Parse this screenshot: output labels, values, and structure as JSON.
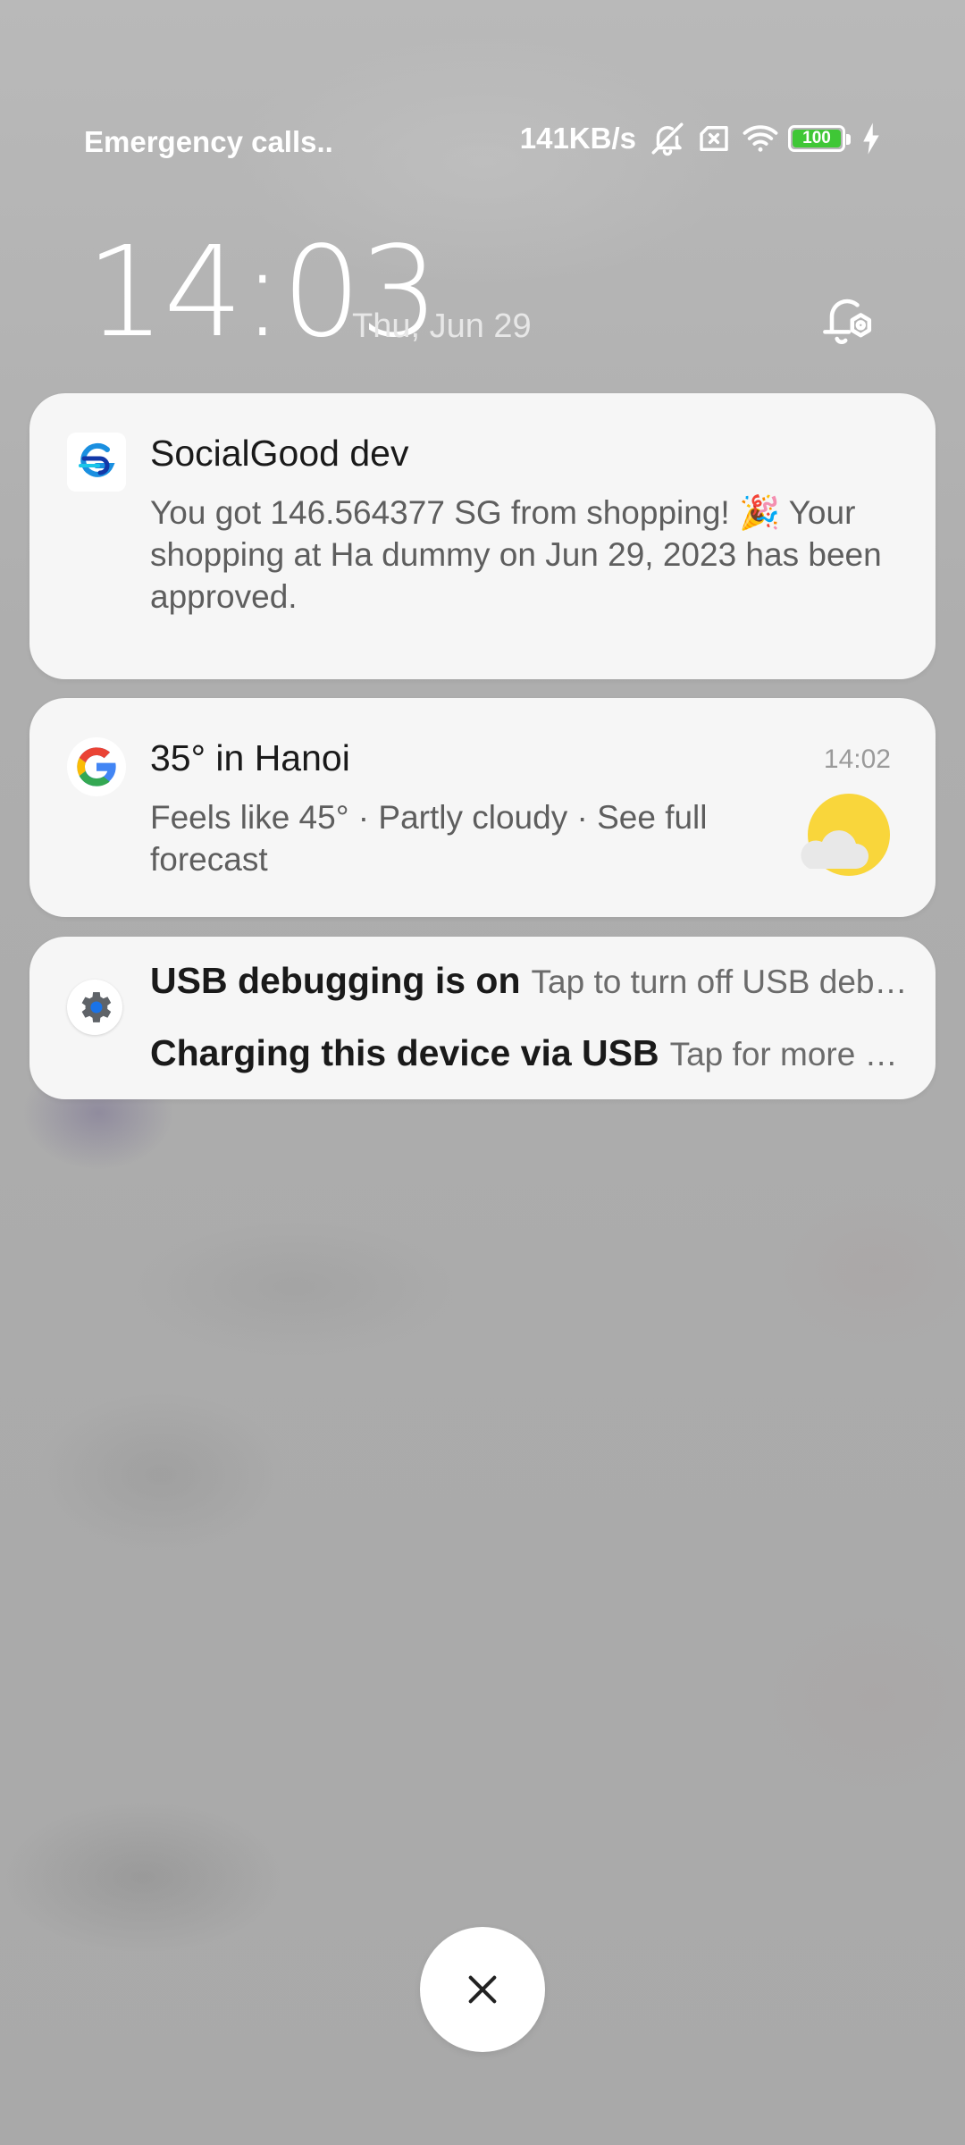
{
  "status_bar": {
    "carrier": "Emergency calls..",
    "net_speed": "141KB/s",
    "battery_level": "100",
    "icons": [
      "alarm-muted-icon",
      "no-sim-icon",
      "wifi-icon",
      "battery-icon",
      "charging-bolt-icon"
    ]
  },
  "lockscreen": {
    "time": "14:03",
    "date": "Thu, Jun 29",
    "alarm_icon": "alarm-settings-icon"
  },
  "notifications": [
    {
      "app_icon": "socialgood-logo-icon",
      "title": "SocialGood dev",
      "body": "You got 146.564377 SG from shopping! 🎉 Your shopping at Ha dummy on Jun 29, 2023 has been approved."
    },
    {
      "app_icon": "google-logo-icon",
      "title": "35° in Hanoi",
      "time": "14:02",
      "body": "Feels like 45° · Partly cloudy · See full forecast",
      "image_icon": "partly-cloudy-icon"
    },
    {
      "app_icon": "android-settings-icon",
      "rows": [
        {
          "title": "USB debugging is on",
          "text": "Tap to turn off USB debugging"
        },
        {
          "title": "Charging this device via USB",
          "text": "Tap for more options"
        }
      ]
    }
  ],
  "close_button": {
    "icon": "close-icon"
  },
  "colors": {
    "background": "#acacac",
    "card": "#f6f6f6",
    "battery_fill": "#3fc736",
    "sun": "#f9d63b"
  }
}
